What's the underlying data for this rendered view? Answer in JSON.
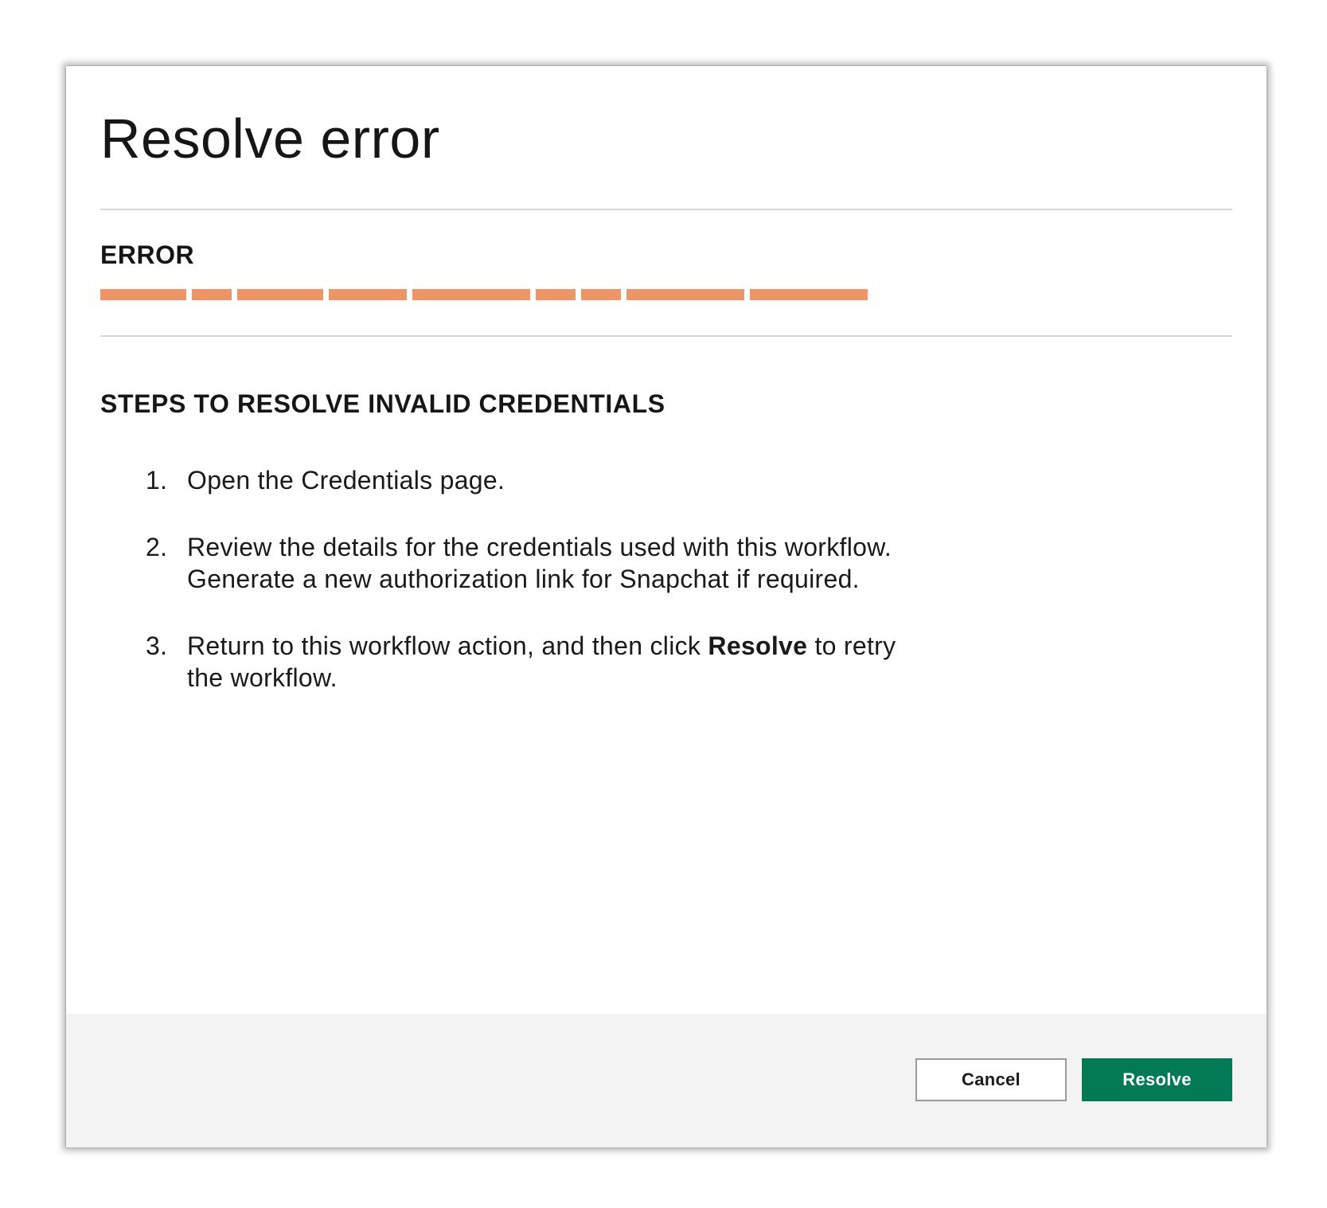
{
  "dialog": {
    "title": "Resolve error",
    "error_heading": "ERROR",
    "error_message_redacted": true,
    "redaction_color": "#ed9567",
    "steps_heading": "STEPS TO RESOLVE INVALID CREDENTIALS",
    "steps": [
      {
        "number": "1.",
        "lines": [
          "Open the Credentials page."
        ]
      },
      {
        "number": "2.",
        "lines": [
          "Review the details for the credentials used with this workflow.",
          "Generate a new authorization link for Snapchat if required."
        ]
      },
      {
        "number": "3.",
        "line1_before": "Return to this workflow action, and then click ",
        "line1_bold": "Resolve",
        "line1_after": " to retry",
        "line2": "the workflow."
      }
    ]
  },
  "footer": {
    "cancel_label": "Cancel",
    "resolve_label": "Resolve",
    "accent_color": "#017a55"
  }
}
